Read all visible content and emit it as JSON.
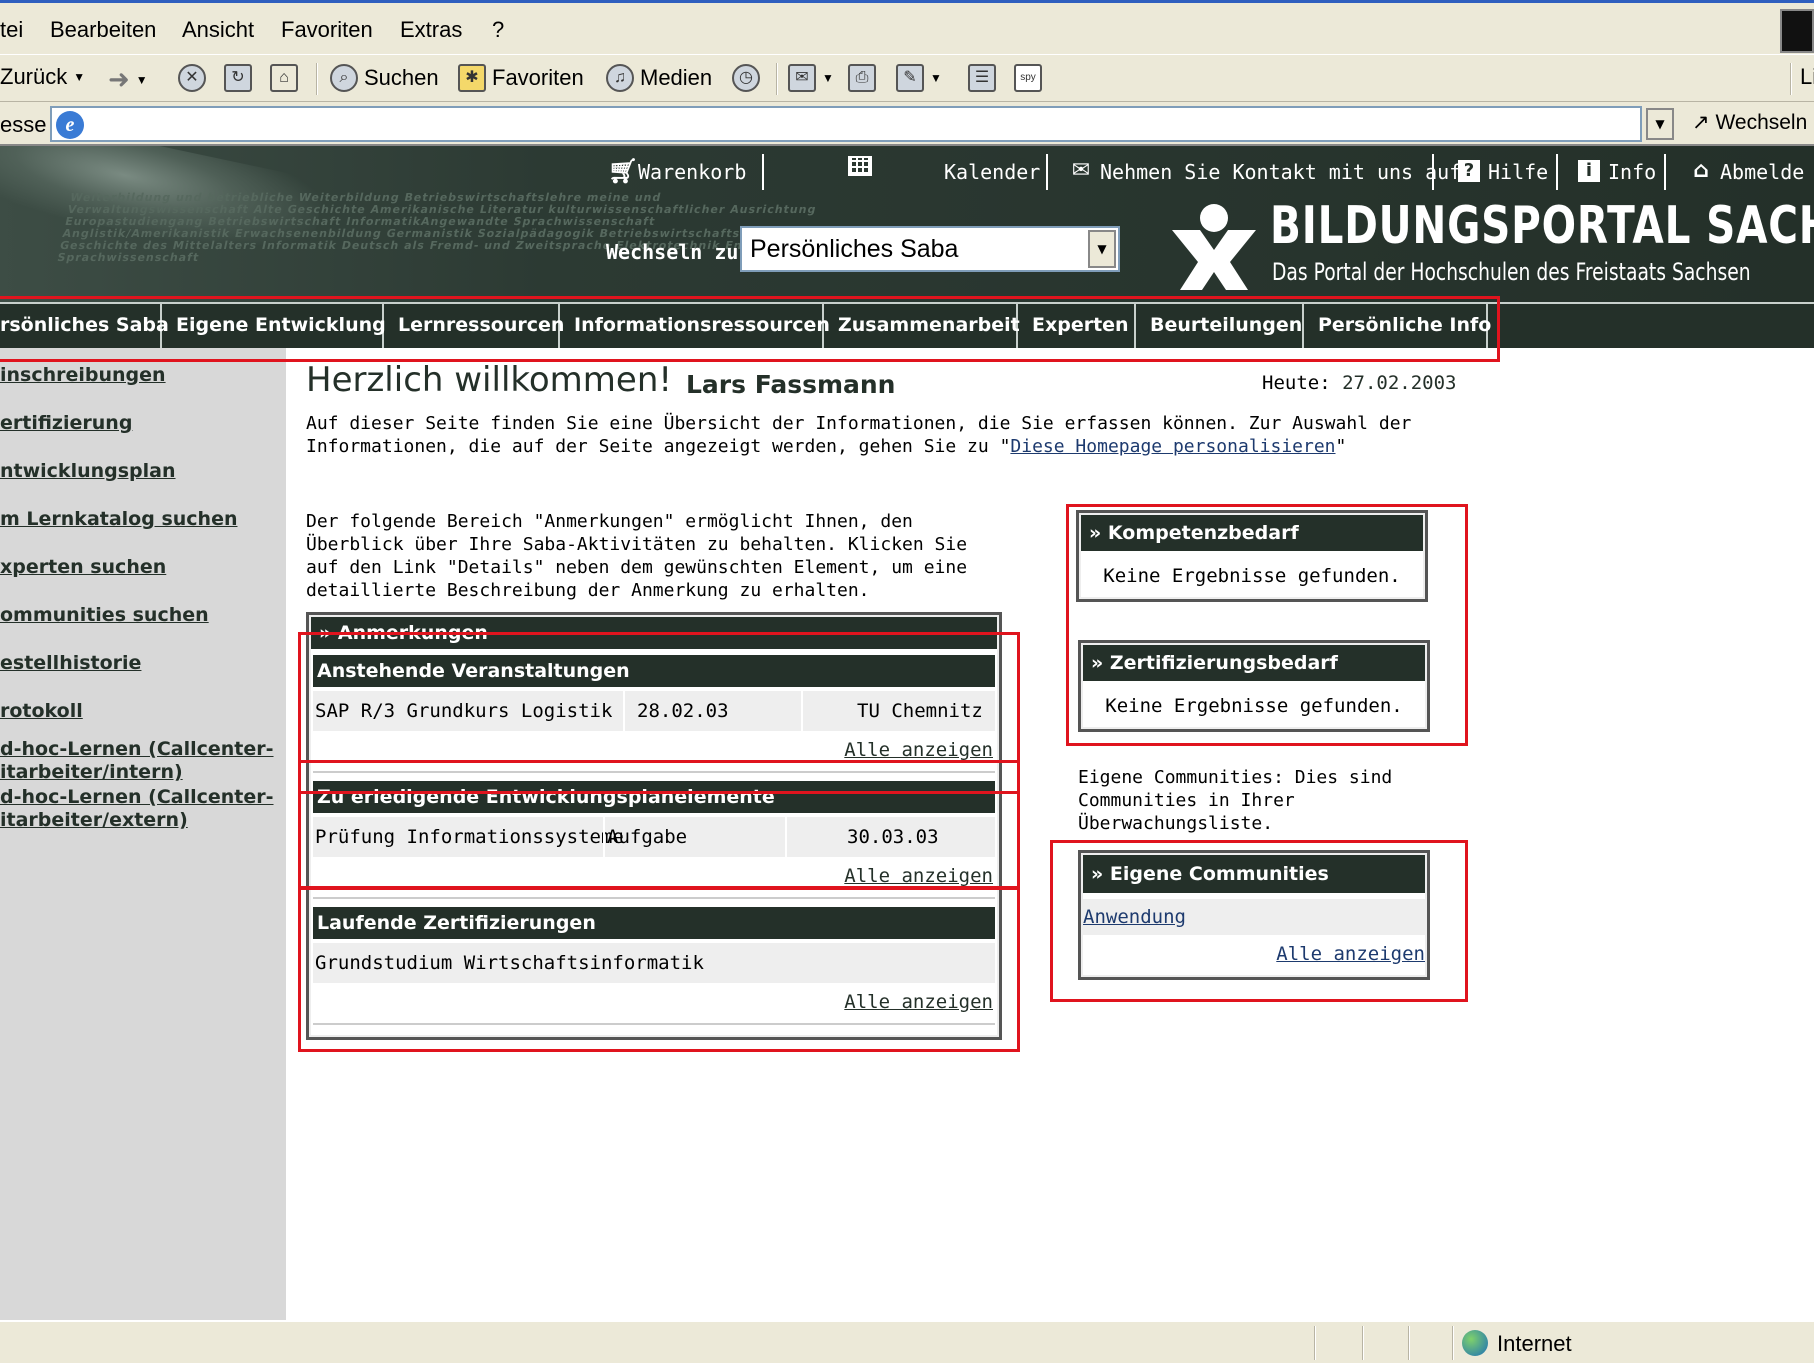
{
  "browser": {
    "menu": [
      "tei",
      "Bearbeiten",
      "Ansicht",
      "Favoriten",
      "Extras",
      "?"
    ],
    "toolbar": {
      "back": "Zurück",
      "search": "Suchen",
      "favorites": "Favoriten",
      "media": "Medien"
    },
    "toolbar_right_label": "Li",
    "address_label": "esse",
    "address_value": "",
    "go_label": "Wechseln"
  },
  "portal": {
    "header_links": {
      "cart": "Warenkorb",
      "calendar": "Kalender",
      "contact": "Nehmen Sie Kontakt mit uns auf",
      "help": "Hilfe",
      "info": "Info",
      "logout": "Abmelde"
    },
    "switch_label": "Wechseln zu:",
    "switch_value": "Persönliches Saba",
    "logo_title": "BILDUNGSPORTAL SACHSEN",
    "logo_subtitle": "Das Portal der Hochschulen des Freistaats Sachsen",
    "bg_text": "Weiterbildung und betriebliche Weiterbildung Betriebswirtschaftslehre meine und Verwaltungswissenschaft Alte Geschichte Amerikanische Literatur kulturwissenschaftlicher Ausrichtung Europastudiengang Betriebswirtschaft InformatikAngewandte Sprachwissenschaft Anglistik/Amerikanistik Erwachsenenbildung Germanistik Sozialpädagogik Betriebswirtschaftslehre Geschichte des Mittelalters Informatik Deutsch als Fremd- und Zweitsprache Elektrotechnik Englische Sprachwissenschaft"
  },
  "nav": {
    "tabs": [
      "rsönliches Saba",
      "Eigene Entwicklung",
      "Lernressourcen",
      "Informationsressourcen",
      "Zusammenarbeit",
      "Experten",
      "Beurteilungen",
      "Persönliche Info"
    ]
  },
  "sidebar": {
    "items": [
      "inschreibungen",
      "ertifizierung",
      "ntwicklungsplan",
      "m Lernkatalog suchen",
      "xperten suchen",
      "ommunities suchen",
      "estellhistorie",
      "rotokoll",
      "d-hoc-Lernen (Callcenter-\nitarbeiter/intern)",
      "d-hoc-Lernen (Callcenter-\nitarbeiter/extern)"
    ]
  },
  "content": {
    "welcome": "Herzlich willkommen!",
    "username": "Lars Fassmann",
    "today_label": "Heute:",
    "today_value": "27.02.2003",
    "intro_before": "Auf dieser Seite finden Sie eine Übersicht der Informationen, die Sie erfassen können. Zur Auswahl der Informationen, die auf der Seite angezeigt werden, gehen Sie zu \"",
    "intro_link": "Diese Homepage personalisieren",
    "intro_after": "\"",
    "notes_intro": "Der folgende Bereich \"Anmerkungen\" ermöglicht Ihnen, den Überblick über Ihre Saba-Aktivitäten zu behalten. Klicken Sie auf den Link \"Details\" neben dem gewünschten Element, um eine detaillierte Beschreibung der Anmerkung zu erhalten.",
    "notes": {
      "title": "» Anmerkungen",
      "sections": [
        {
          "title": "Anstehende Veranstaltungen",
          "row": [
            "SAP R/3 Grundkurs Logistik",
            "28.02.03",
            "TU Chemnitz"
          ],
          "all": "Alle anzeigen"
        },
        {
          "title": "Zu erledigende Entwicklungsplanelemente",
          "row": [
            "Prüfung Informationssysteme",
            "Aufgabe",
            "30.03.03"
          ],
          "all": "Alle anzeigen"
        },
        {
          "title": "Laufende Zertifizierungen",
          "row": [
            "Grundstudium Wirtschaftsinformatik"
          ],
          "all": "Alle anzeigen"
        }
      ]
    },
    "competence": {
      "title": "» Kompetenzbedarf",
      "empty": "Keine Ergebnisse gefunden."
    },
    "certification": {
      "title": "» Zertifizierungsbedarf",
      "empty": "Keine Ergebnisse gefunden."
    },
    "communities_intro": "Eigene Communities: Dies sind Communities in Ihrer Überwachungsliste.",
    "communities": {
      "title": "» Eigene Communities",
      "item": "Anwendung",
      "all": "Alle anzeigen"
    }
  },
  "status": {
    "zone": "Internet"
  },
  "colors": {
    "portal_dark": "#243029",
    "annotation_red": "#e0141e",
    "sidebar_bg": "#d8d8d8"
  }
}
